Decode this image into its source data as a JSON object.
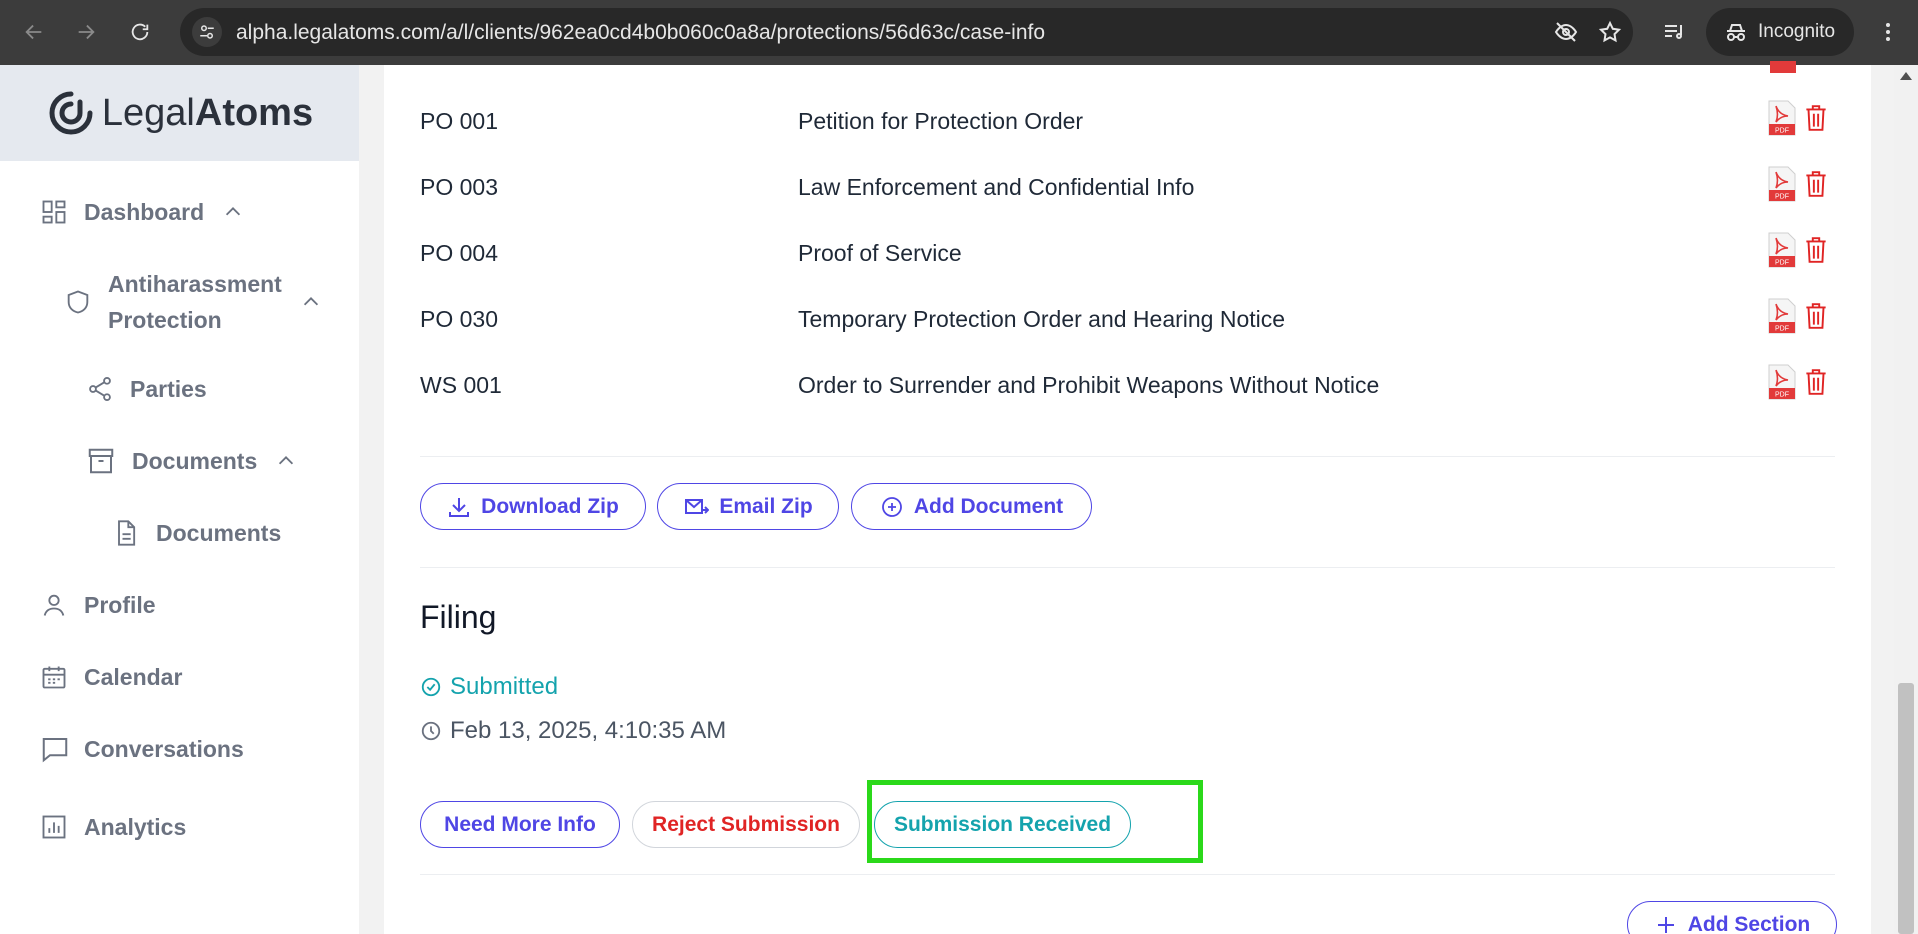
{
  "browser": {
    "url": "alpha.legalatoms.com/a/l/clients/962ea0cd4b0b060c0a8a/protections/56d63c/case-info",
    "incognito_label": "Incognito"
  },
  "sidebar": {
    "brand_light": "Legal",
    "brand_bold": "Atoms",
    "dashboard": "Dashboard",
    "antiharassment_line1": "Antiharassment",
    "antiharassment_line2": "Protection",
    "parties": "Parties",
    "documents_group": "Documents",
    "documents_leaf": "Documents",
    "profile": "Profile",
    "calendar": "Calendar",
    "conversations": "Conversations",
    "analytics": "Analytics"
  },
  "documents": {
    "rows": [
      {
        "code": "PO 001",
        "title": "Petition for Protection Order"
      },
      {
        "code": "PO 003",
        "title": "Law Enforcement and Confidential Info"
      },
      {
        "code": "PO 004",
        "title": "Proof of Service"
      },
      {
        "code": "PO 030",
        "title": "Temporary Protection Order and Hearing Notice"
      },
      {
        "code": "WS 001",
        "title": "Order to Surrender and Prohibit Weapons Without Notice"
      }
    ],
    "download_zip": "Download Zip",
    "email_zip": "Email Zip",
    "add_document": "Add Document"
  },
  "filing": {
    "title": "Filing",
    "status": "Submitted",
    "timestamp": "Feb 13, 2025, 4:10:35 AM",
    "need_more_info": "Need More Info",
    "reject_submission": "Reject Submission",
    "submission_received": "Submission Received"
  },
  "add_section": "Add Section",
  "colors": {
    "primary": "#4f46e5",
    "teal": "#14a3ad",
    "danger": "#e02424",
    "highlight": "#2bd91a"
  }
}
